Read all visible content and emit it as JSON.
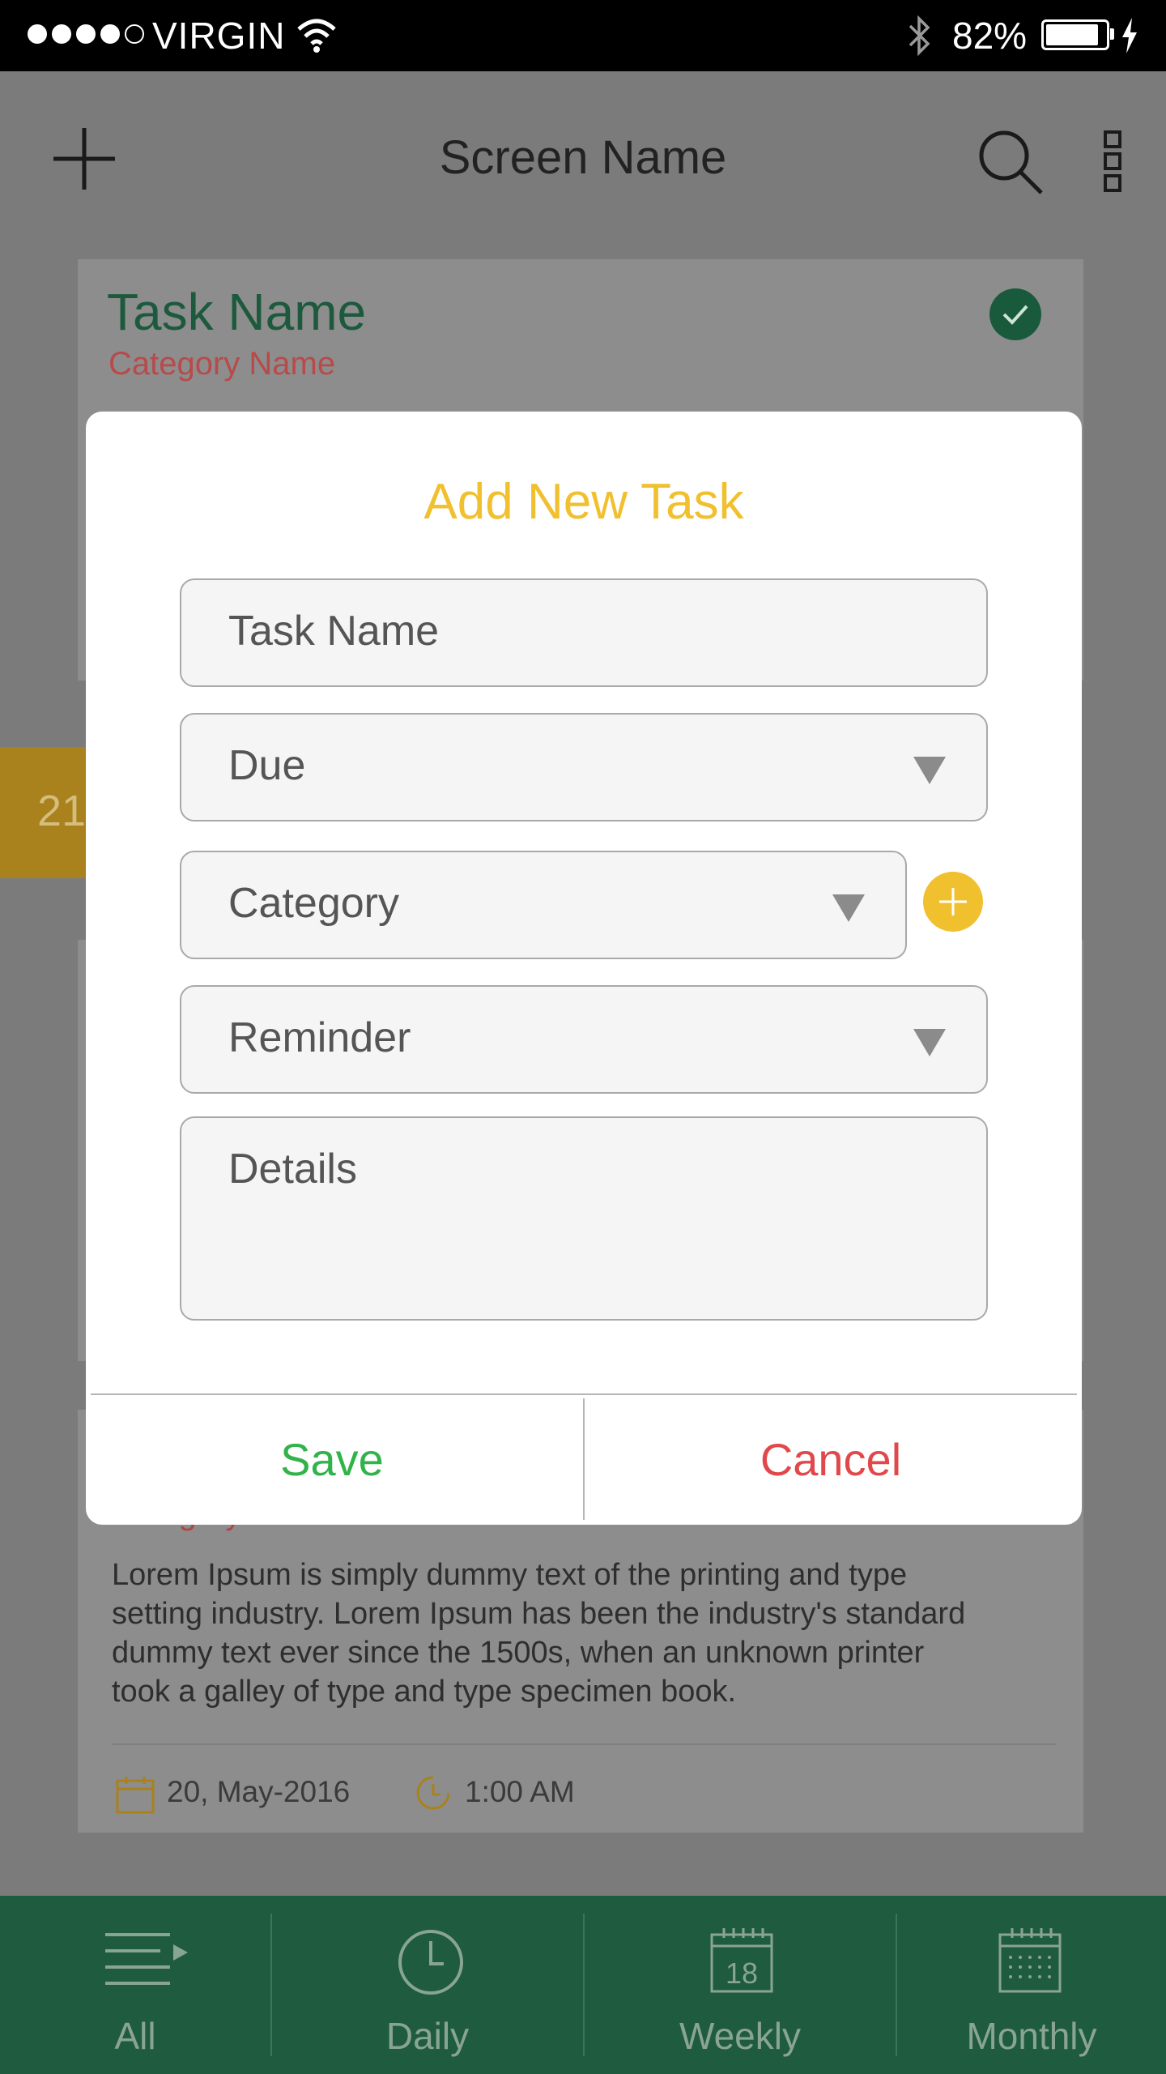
{
  "status_bar": {
    "carrier": "VIRGIN",
    "battery_percent": "82%",
    "battery_level": 0.82,
    "signal_bars_filled": 4,
    "signal_bars_total": 5
  },
  "app_bar": {
    "title": "Screen Name",
    "icons": [
      "plus-icon",
      "search-icon",
      "more-vertical-icon"
    ]
  },
  "background_card_1": {
    "task_name": "Task Name",
    "category_name": "Category Name",
    "check_color": "#1a5a3c"
  },
  "background_date_badge": {
    "text": "21"
  },
  "background_card_2": {
    "category_name": "Category Name",
    "description_lines": [
      "Lorem Ipsum is simply dummy text of the printing and type",
      "setting industry. Lorem Ipsum has been the industry's standard",
      "dummy text ever since the 1500s, when an unknown printer",
      "took a galley of type and type specimen book."
    ],
    "date": "20, May-2016",
    "time": "1:00 AM"
  },
  "modal": {
    "title": "Add New Task",
    "fields": {
      "task_name_placeholder": "Task Name",
      "due_placeholder": "Due",
      "category_placeholder": "Category",
      "reminder_placeholder": "Reminder",
      "details_placeholder": "Details"
    },
    "save_label": "Save",
    "cancel_label": "Cancel"
  },
  "bottom_nav": {
    "items": [
      {
        "label": "All",
        "icon": "list-icon"
      },
      {
        "label": "Daily",
        "icon": "clock-icon"
      },
      {
        "label": "Weekly",
        "icon": "calendar-week-icon",
        "calendar_day": "18"
      },
      {
        "label": "Monthly",
        "icon": "calendar-month-icon"
      }
    ]
  },
  "colors": {
    "accent_yellow": "#f1c02f",
    "save_green": "#31b34a",
    "cancel_red": "#e1484b",
    "nav_green": "#1e5b3f"
  }
}
